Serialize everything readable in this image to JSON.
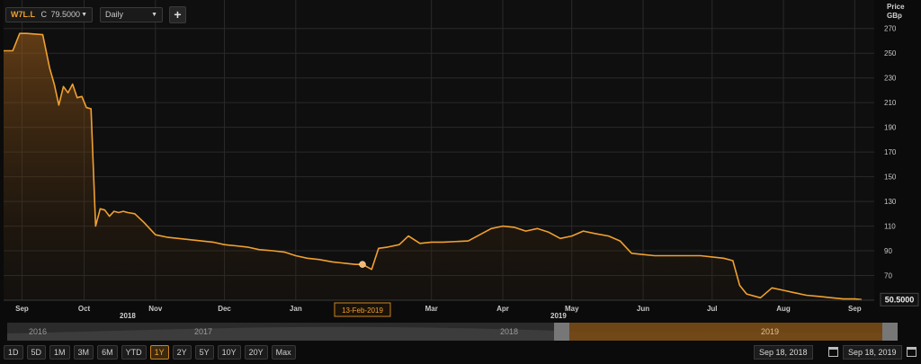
{
  "toolbar": {
    "symbol": "W7L.L",
    "close_label": "C",
    "close_value": "79.5000",
    "interval": "Daily",
    "add_icon": "plus-icon"
  },
  "colors": {
    "line": "#f0a030",
    "background": "#0b0b0b",
    "grid": "#2a2a2a",
    "accent": "#c98420"
  },
  "chart_data": {
    "type": "area",
    "ylabel": "Price\nGBp",
    "y_ticks": [
      70,
      90,
      110,
      130,
      150,
      170,
      190,
      210,
      230,
      250,
      270
    ],
    "ylim": [
      50,
      280
    ],
    "x_ticks": [
      {
        "label": "Sep",
        "date": "2018-09-18"
      },
      {
        "label": "Oct",
        "date": "2018-10-15"
      },
      {
        "label": "Nov",
        "date": "2018-11-15"
      },
      {
        "label": "Dec",
        "date": "2018-12-15"
      },
      {
        "label": "Jan",
        "date": "2019-01-15"
      },
      {
        "label": "Mar",
        "date": "2019-03-15"
      },
      {
        "label": "Apr",
        "date": "2019-04-15"
      },
      {
        "label": "May",
        "date": "2019-05-15"
      },
      {
        "label": "Jun",
        "date": "2019-06-15"
      },
      {
        "label": "Jul",
        "date": "2019-07-15"
      },
      {
        "label": "Aug",
        "date": "2019-08-15"
      },
      {
        "label": "Sep",
        "date": "2019-09-15"
      }
    ],
    "year_labels": [
      {
        "label": "2018",
        "date": "2018-11-08"
      },
      {
        "label": "2019",
        "date": "2019-05-11"
      }
    ],
    "xlim": [
      "2018-09-10",
      "2019-09-18"
    ],
    "highlight": {
      "label": "13-Feb-2019",
      "date": "2019-02-13",
      "value": 79
    },
    "last_value_label": "50.5000",
    "last_value": 50.5,
    "grid": true,
    "legend": "none",
    "series": [
      {
        "x": [
          "2018-09-10",
          "2018-09-14",
          "2018-09-17",
          "2018-09-20",
          "2018-09-27",
          "2018-09-30",
          "2018-10-02",
          "2018-10-04",
          "2018-10-06",
          "2018-10-08",
          "2018-10-10",
          "2018-10-12",
          "2018-10-14",
          "2018-10-16",
          "2018-10-18",
          "2018-10-20",
          "2018-10-22",
          "2018-10-24",
          "2018-10-26",
          "2018-10-28",
          "2018-10-30",
          "2018-11-01",
          "2018-11-03",
          "2018-11-06",
          "2018-11-10",
          "2018-11-15",
          "2018-11-20",
          "2018-11-25",
          "2018-11-30",
          "2018-12-05",
          "2018-12-10",
          "2018-12-15",
          "2018-12-20",
          "2018-12-25",
          "2018-12-30",
          "2019-01-05",
          "2019-01-10",
          "2019-01-15",
          "2019-01-20",
          "2019-01-25",
          "2019-01-31",
          "2019-02-05",
          "2019-02-10",
          "2019-02-13",
          "2019-02-17",
          "2019-02-20",
          "2019-02-24",
          "2019-03-01",
          "2019-03-05",
          "2019-03-10",
          "2019-03-15",
          "2019-03-20",
          "2019-03-31",
          "2019-04-05",
          "2019-04-10",
          "2019-04-15",
          "2019-04-20",
          "2019-04-25",
          "2019-04-30",
          "2019-05-05",
          "2019-05-10",
          "2019-05-15",
          "2019-05-20",
          "2019-05-25",
          "2019-05-31",
          "2019-06-05",
          "2019-06-10",
          "2019-06-15",
          "2019-06-20",
          "2019-06-25",
          "2019-06-30",
          "2019-07-05",
          "2019-07-10",
          "2019-07-15",
          "2019-07-20",
          "2019-07-24",
          "2019-07-27",
          "2019-07-30",
          "2019-08-05",
          "2019-08-10",
          "2019-08-15",
          "2019-08-20",
          "2019-08-25",
          "2019-08-31",
          "2019-09-05",
          "2019-09-10",
          "2019-09-15",
          "2019-09-18"
        ],
        "values": [
          252,
          252,
          266,
          266,
          265,
          238,
          225,
          208,
          223,
          218,
          225,
          214,
          215,
          206,
          205,
          110,
          124,
          123,
          118,
          122,
          121,
          122,
          121,
          120,
          113,
          103,
          101,
          100,
          99,
          98,
          97,
          95,
          94,
          93,
          91,
          90,
          89,
          86,
          84,
          83,
          81,
          80,
          79,
          79,
          75,
          92,
          93,
          95,
          102,
          96,
          97,
          97,
          98,
          103,
          108,
          110,
          109,
          106,
          108,
          105,
          100,
          102,
          106,
          104,
          102,
          98,
          88,
          87,
          86,
          86,
          86,
          86,
          86,
          85,
          84,
          82,
          62,
          55,
          52,
          60,
          58,
          56,
          54,
          53,
          52,
          51,
          51,
          50.5
        ]
      }
    ]
  },
  "navigator": {
    "years": [
      "2016",
      "2017",
      "2018",
      "2019"
    ],
    "year_labels": [
      "2018",
      "2019"
    ]
  },
  "range_buttons": [
    "1D",
    "5D",
    "1M",
    "3M",
    "6M",
    "YTD",
    "1Y",
    "2Y",
    "5Y",
    "10Y",
    "20Y",
    "Max"
  ],
  "range_active": "1Y",
  "date_range": {
    "start": "Sep 18, 2018",
    "end": "Sep 18, 2019"
  }
}
